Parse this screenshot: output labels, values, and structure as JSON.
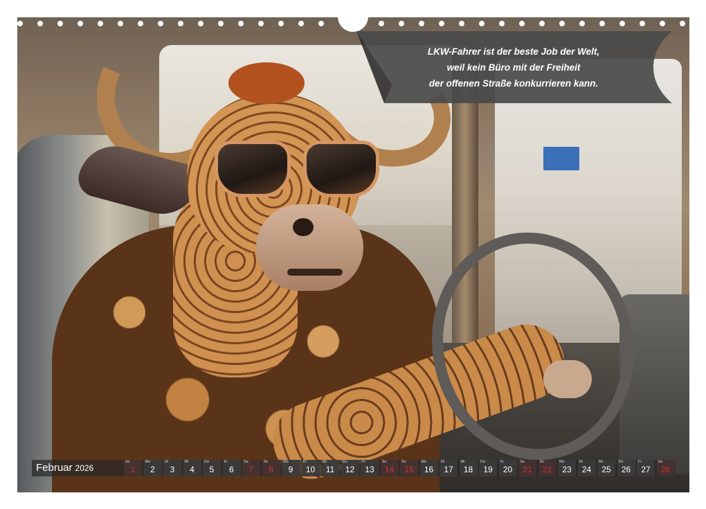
{
  "banner": {
    "lines": [
      "LKW-Fahrer ist der beste Job der Welt,",
      "weil kein Büro mit der Freiheit",
      "der offenen Straße konkurrieren kann."
    ],
    "color": "#4a4a4a"
  },
  "calendar": {
    "month": "Februar",
    "year": "2026",
    "weekend_color": "#d03030",
    "days": [
      {
        "wd": "So",
        "n": "1",
        "red": true
      },
      {
        "wd": "Mo",
        "n": "2",
        "red": false
      },
      {
        "wd": "Di",
        "n": "3",
        "red": false
      },
      {
        "wd": "Mi",
        "n": "4",
        "red": false
      },
      {
        "wd": "Do",
        "n": "5",
        "red": false
      },
      {
        "wd": "Fr",
        "n": "6",
        "red": false
      },
      {
        "wd": "Sa",
        "n": "7",
        "red": true
      },
      {
        "wd": "So",
        "n": "8",
        "red": true
      },
      {
        "wd": "Mo",
        "n": "9",
        "red": false
      },
      {
        "wd": "Di",
        "n": "10",
        "red": false
      },
      {
        "wd": "Mi",
        "n": "11",
        "red": false
      },
      {
        "wd": "Do",
        "n": "12",
        "red": false
      },
      {
        "wd": "Fr",
        "n": "13",
        "red": false
      },
      {
        "wd": "Sa",
        "n": "14",
        "red": true
      },
      {
        "wd": "So",
        "n": "15",
        "red": true
      },
      {
        "wd": "Mo",
        "n": "16",
        "red": false
      },
      {
        "wd": "Di",
        "n": "17",
        "red": false
      },
      {
        "wd": "Mi",
        "n": "18",
        "red": false
      },
      {
        "wd": "Do",
        "n": "19",
        "red": false
      },
      {
        "wd": "Fr",
        "n": "20",
        "red": false
      },
      {
        "wd": "Sa",
        "n": "21",
        "red": true
      },
      {
        "wd": "So",
        "n": "22",
        "red": true
      },
      {
        "wd": "Mo",
        "n": "23",
        "red": false
      },
      {
        "wd": "Di",
        "n": "24",
        "red": false
      },
      {
        "wd": "Mi",
        "n": "25",
        "red": false
      },
      {
        "wd": "Do",
        "n": "26",
        "red": false
      },
      {
        "wd": "Fr",
        "n": "27",
        "red": false
      },
      {
        "wd": "Sa",
        "n": "28",
        "red": true
      }
    ]
  },
  "photo": {
    "subject": "giraffe-bull-driver-icon"
  }
}
